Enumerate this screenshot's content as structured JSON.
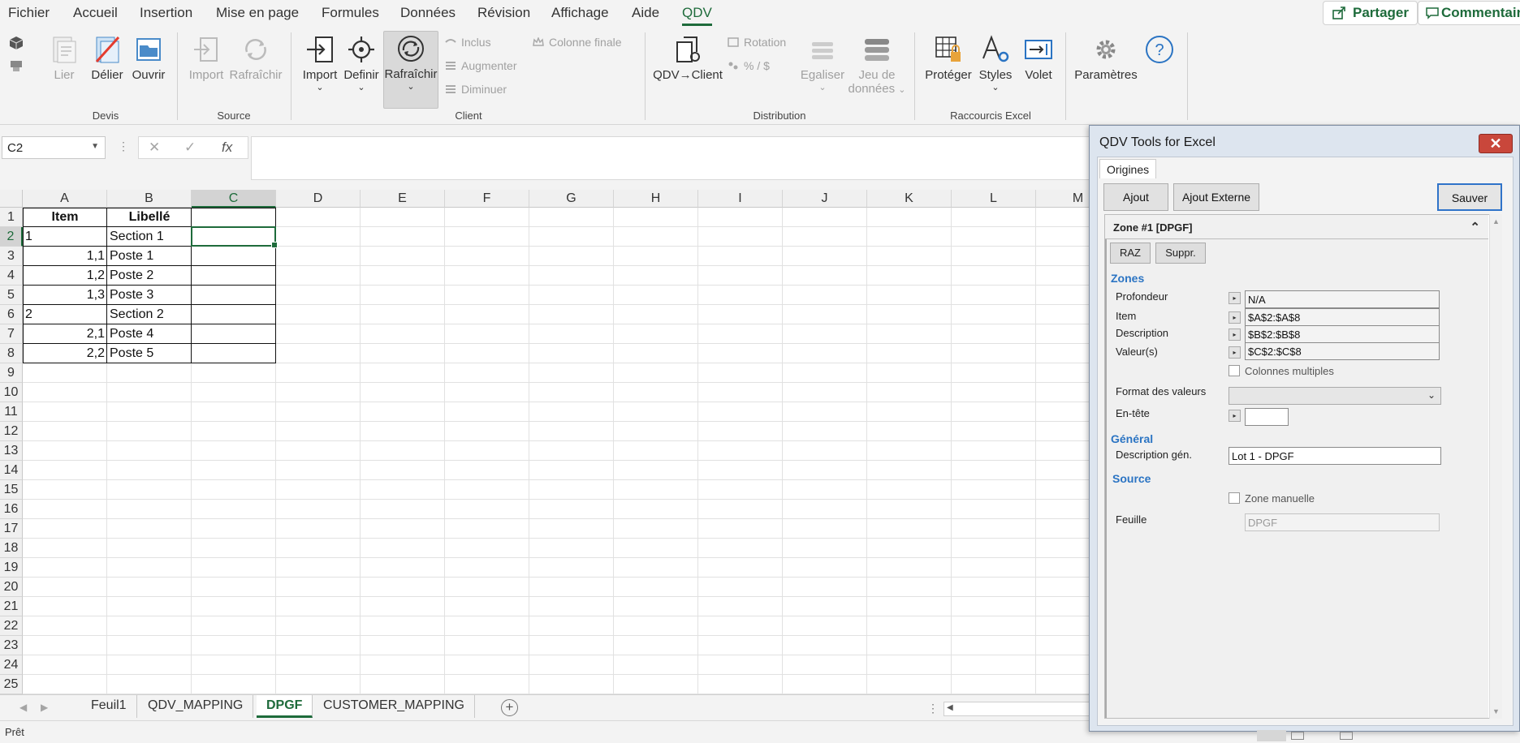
{
  "menu": {
    "tabs": [
      "Fichier",
      "Accueil",
      "Insertion",
      "Mise en page",
      "Formules",
      "Données",
      "Révision",
      "Affichage",
      "Aide",
      "QDV"
    ],
    "active_tab": "QDV",
    "share_label": "Partager",
    "comment_label": "Commentair"
  },
  "ribbon": {
    "groups": {
      "devis": "Devis",
      "source": "Source",
      "client": "Client",
      "distribution": "Distribution",
      "raccourcis": "Raccourcis Excel"
    },
    "buttons": {
      "lier": "Lier",
      "delier": "Délier",
      "ouvrir": "Ouvrir",
      "import_source": "Import",
      "rafraichir_source": "Rafraîchir",
      "import_client": "Import",
      "definir": "Definir",
      "rafraichir_client": "Rafraîchir",
      "inclus": "Inclus",
      "augmenter": "Augmenter",
      "diminuer": "Diminuer",
      "colonne_finale": "Colonne finale",
      "qdv_client": "QDV→Client",
      "rotation": "Rotation",
      "pct": "% / $",
      "egaliser": "Egaliser",
      "jeu_de": "Jeu de",
      "donnees": "données",
      "proteger": "Protéger",
      "styles": "Styles",
      "volet": "Volet",
      "parametres": "Paramètres"
    }
  },
  "formula_bar": {
    "name_box": "C2",
    "fx": "fx",
    "value": ""
  },
  "sheet": {
    "columns": [
      "A",
      "B",
      "C",
      "D",
      "E",
      "F",
      "G",
      "H",
      "I",
      "J",
      "K",
      "L",
      "M"
    ],
    "rows": [
      "1",
      "2",
      "3",
      "4",
      "5",
      "6",
      "7",
      "8",
      "9",
      "10",
      "11",
      "12",
      "13",
      "14",
      "15",
      "16",
      "17",
      "18",
      "19",
      "20",
      "21",
      "22",
      "23",
      "24",
      "25"
    ],
    "selected_col": "C",
    "selected_row": "2",
    "cells": [
      {
        "col": 0,
        "row": 0,
        "text": "Item",
        "kind": "hdr"
      },
      {
        "col": 1,
        "row": 0,
        "text": "Libellé",
        "kind": "hdr"
      },
      {
        "col": 0,
        "row": 1,
        "text": "1",
        "kind": "text"
      },
      {
        "col": 1,
        "row": 1,
        "text": "Section 1",
        "kind": "text"
      },
      {
        "col": 0,
        "row": 2,
        "text": "1,1",
        "kind": "num"
      },
      {
        "col": 1,
        "row": 2,
        "text": "Poste 1",
        "kind": "text"
      },
      {
        "col": 0,
        "row": 3,
        "text": "1,2",
        "kind": "num"
      },
      {
        "col": 1,
        "row": 3,
        "text": "Poste 2",
        "kind": "text"
      },
      {
        "col": 0,
        "row": 4,
        "text": "1,3",
        "kind": "num"
      },
      {
        "col": 1,
        "row": 4,
        "text": "Poste 3",
        "kind": "text"
      },
      {
        "col": 0,
        "row": 5,
        "text": "2",
        "kind": "text"
      },
      {
        "col": 1,
        "row": 5,
        "text": "Section 2",
        "kind": "text"
      },
      {
        "col": 0,
        "row": 6,
        "text": "2,1",
        "kind": "num"
      },
      {
        "col": 1,
        "row": 6,
        "text": "Poste 4",
        "kind": "text"
      },
      {
        "col": 0,
        "row": 7,
        "text": "2,2",
        "kind": "num"
      },
      {
        "col": 1,
        "row": 7,
        "text": "Poste 5",
        "kind": "text"
      }
    ]
  },
  "sheet_tabs": {
    "tabs": [
      "Feuil1",
      "QDV_MAPPING",
      "DPGF",
      "CUSTOMER_MAPPING"
    ],
    "active": "DPGF"
  },
  "status": {
    "text": "Prêt"
  },
  "qdv_panel": {
    "title": "QDV Tools for Excel",
    "tab": "Origines",
    "btn_ajout": "Ajout",
    "btn_ajout_externe": "Ajout Externe",
    "btn_sauver": "Sauver",
    "zone_title": "Zone #1 [DPGF]",
    "btn_raz": "RAZ",
    "btn_suppr": "Suppr.",
    "sec_zones": "Zones",
    "lbl_profondeur": "Profondeur",
    "val_profondeur": "N/A",
    "lbl_item": "Item",
    "val_item": "$A$2:$A$8",
    "lbl_description": "Description",
    "val_description": "$B$2:$B$8",
    "lbl_valeurs": "Valeur(s)",
    "val_valeurs": "$C$2:$C$8",
    "lbl_colonnes_multiples": "Colonnes multiples",
    "lbl_format": "Format des valeurs",
    "lbl_entete": "En-tête",
    "sec_general": "Général",
    "lbl_desc_gen": "Description gén.",
    "val_desc_gen": "Lot 1 - DPGF",
    "sec_source": "Source",
    "lbl_zone_manuelle": "Zone manuelle",
    "lbl_feuille": "Feuille",
    "val_feuille": "DPGF"
  },
  "colors": {
    "excel_green": "#1e6b3b",
    "accent_blue": "#2b74c3",
    "close_red": "#c9473b"
  }
}
